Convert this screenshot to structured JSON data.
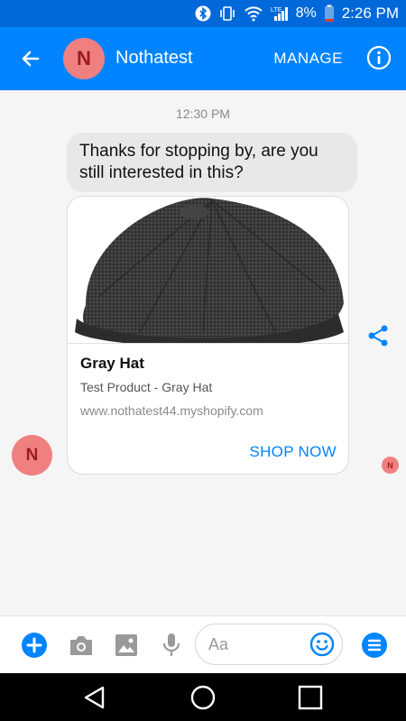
{
  "status_bar": {
    "battery": "8%",
    "time": "2:26 PM"
  },
  "header": {
    "avatar_letter": "N",
    "title": "Nothatest",
    "manage_label": "MANAGE"
  },
  "chat": {
    "timestamp": "12:30 PM",
    "message": "Thanks for stopping by, are you still interested in this?",
    "card": {
      "title": "Gray Hat",
      "subtitle": "Test Product - Gray Hat",
      "url": "www.nothatest44.myshopify.com",
      "button_label": "SHOP NOW"
    },
    "avatar_letter": "N",
    "read_receipt_letter": "N"
  },
  "composer": {
    "placeholder": "Aa"
  },
  "colors": {
    "brand": "#0084ff",
    "status_bar": "#0069d9",
    "avatar": "#f08080"
  },
  "icons": [
    "bluetooth-icon",
    "vibrate-icon",
    "wifi-icon",
    "lte-icon",
    "signal-icon",
    "battery-icon",
    "back-arrow-icon",
    "info-icon",
    "share-icon",
    "plus-icon",
    "camera-icon",
    "image-icon",
    "microphone-icon",
    "emoji-icon",
    "menu-icon",
    "nav-back-icon",
    "nav-home-icon",
    "nav-recents-icon"
  ]
}
